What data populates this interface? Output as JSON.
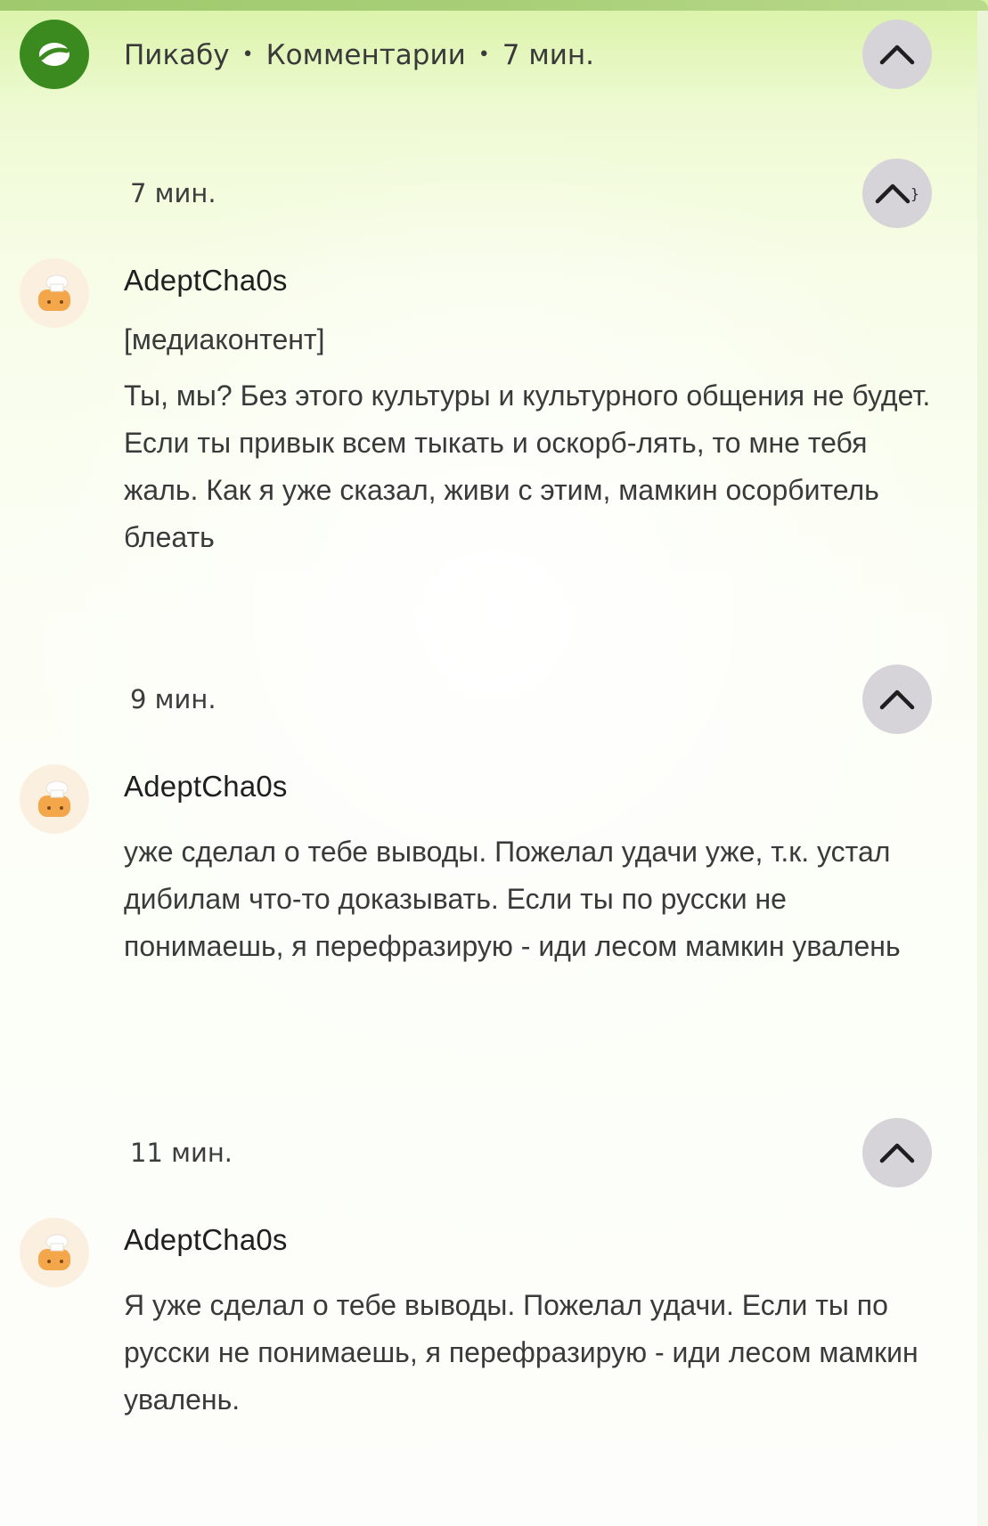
{
  "header": {
    "source": "Пикабу",
    "section": "Комментарии",
    "time": "7 мин.",
    "separator": "•",
    "logo_icon": "pikabu-logo-icon",
    "collapse_icon": "chevron-up-icon"
  },
  "colors": {
    "logo_green": "#3a8a1f",
    "button_gray": "#d6d4d8",
    "top_bar": "#a8cf78"
  },
  "comments": [
    {
      "time": "7 мин.",
      "author": "AdeptCha0s",
      "media": "[медиаконтент]",
      "text": "Ты, мы? Без этого культуры и культурного общения не будет. Если ты привык всем тыкать и оскорб-лять, то мне тебя жаль. Как я уже сказал, живи с этим, мамкин осорбитель блеать"
    },
    {
      "time": "9 мин.",
      "author": "AdeptCha0s",
      "text": "уже сделал о тебе выводы. Пожелал удачи уже, т.к. устал дибилам что-то доказывать. Если ты по русски не понимаешь, я перефразирую - иди лесом мамкин увалень"
    },
    {
      "time": "11 мин.",
      "author": "AdeptCha0s",
      "text": "Я уже сделал о тебе выводы. Пожелал удачи. Если ты по русски не понимаешь, я перефразирую - иди лесом мамкин увалень."
    }
  ]
}
